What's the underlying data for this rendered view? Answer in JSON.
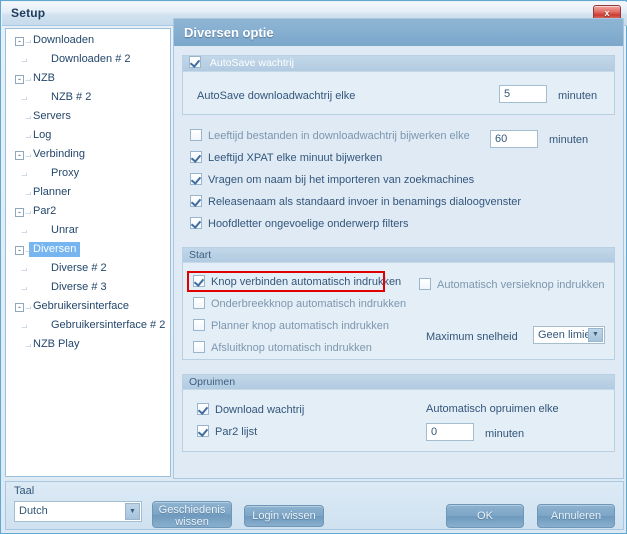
{
  "window": {
    "title": "Setup",
    "close_label": "x"
  },
  "sidebar": {
    "items": [
      {
        "label": "Downloaden",
        "level": 0,
        "expander": "-",
        "selected": false
      },
      {
        "label": "Downloaden # 2",
        "level": 1,
        "expander": "",
        "selected": false
      },
      {
        "label": "NZB",
        "level": 0,
        "expander": "-",
        "selected": false
      },
      {
        "label": "NZB # 2",
        "level": 1,
        "expander": "",
        "selected": false
      },
      {
        "label": "Servers",
        "level": 0,
        "expander": "",
        "selected": false
      },
      {
        "label": "Log",
        "level": 0,
        "expander": "",
        "selected": false
      },
      {
        "label": "Verbinding",
        "level": 0,
        "expander": "-",
        "selected": false
      },
      {
        "label": "Proxy",
        "level": 1,
        "expander": "",
        "selected": false
      },
      {
        "label": "Planner",
        "level": 0,
        "expander": "",
        "selected": false
      },
      {
        "label": "Par2",
        "level": 0,
        "expander": "-",
        "selected": false
      },
      {
        "label": "Unrar",
        "level": 1,
        "expander": "",
        "selected": false
      },
      {
        "label": "Diversen",
        "level": 0,
        "expander": "-",
        "selected": true
      },
      {
        "label": "Diverse # 2",
        "level": 1,
        "expander": "",
        "selected": false
      },
      {
        "label": "Diverse # 3",
        "level": 1,
        "expander": "",
        "selected": false
      },
      {
        "label": "Gebruikersinterface",
        "level": 0,
        "expander": "-",
        "selected": false
      },
      {
        "label": "Gebruikersinterface # 2",
        "level": 1,
        "expander": "",
        "selected": false
      },
      {
        "label": "NZB Play",
        "level": 0,
        "expander": "",
        "selected": false
      }
    ]
  },
  "content": {
    "header": "Diversen optie",
    "autosave": {
      "caption": "AutoSave wachtrij",
      "caption_checked": true,
      "interval_label": "AutoSave downloadwachtrij elke",
      "interval_value": "5",
      "interval_unit": "minuten"
    },
    "loose_options": [
      {
        "label": "Leeftijd bestanden in downloadwachtrij bijwerken elke",
        "checked": false
      },
      {
        "label": "Leeftijd XPAT elke minuut bijwerken",
        "checked": true
      },
      {
        "label": "Vragen om naam bij het importeren van zoekmachines",
        "checked": true
      },
      {
        "label": "Releasenaam als standaard invoer in benamings dialoogvenster",
        "checked": true
      },
      {
        "label": "Hoofdletter ongevoelige onderwerp filters",
        "checked": true
      }
    ],
    "age_value": "60",
    "age_unit": "minuten",
    "start": {
      "caption": "Start",
      "left_options": [
        {
          "label": "Knop verbinden automatisch indrukken",
          "checked": true,
          "highlighted": true
        },
        {
          "label": "Onderbreekknop automatisch indrukken",
          "checked": false,
          "highlighted": false
        },
        {
          "label": "Planner knop automatisch indrukken",
          "checked": false,
          "highlighted": false
        },
        {
          "label": "Afsluitknop utomatisch indrukken",
          "checked": false,
          "highlighted": false
        }
      ],
      "right_option": {
        "label": "Automatisch versieknop indrukken",
        "checked": false
      },
      "speed_label": "Maximum snelheid",
      "speed_value": "Geen limiet"
    },
    "cleanup": {
      "caption": "Opruimen",
      "options": [
        {
          "label": "Download wachtrij",
          "checked": true
        },
        {
          "label": "Par2 lijst",
          "checked": true
        }
      ],
      "auto_label": "Automatisch opruimen elke",
      "auto_value": "0",
      "auto_unit": "minuten"
    }
  },
  "bottom": {
    "language_label": "Taal",
    "language_value": "Dutch",
    "history_button": "Geschiedenis wissen",
    "history_button_line1": "Geschiedenis",
    "history_button_line2": "wissen",
    "login_button": "Login wissen",
    "ok_button": "OK",
    "cancel_button": "Annuleren"
  },
  "colors": {
    "accent": "#76b5f0",
    "highlight": "#e00000",
    "header": "#7ba7cb"
  }
}
